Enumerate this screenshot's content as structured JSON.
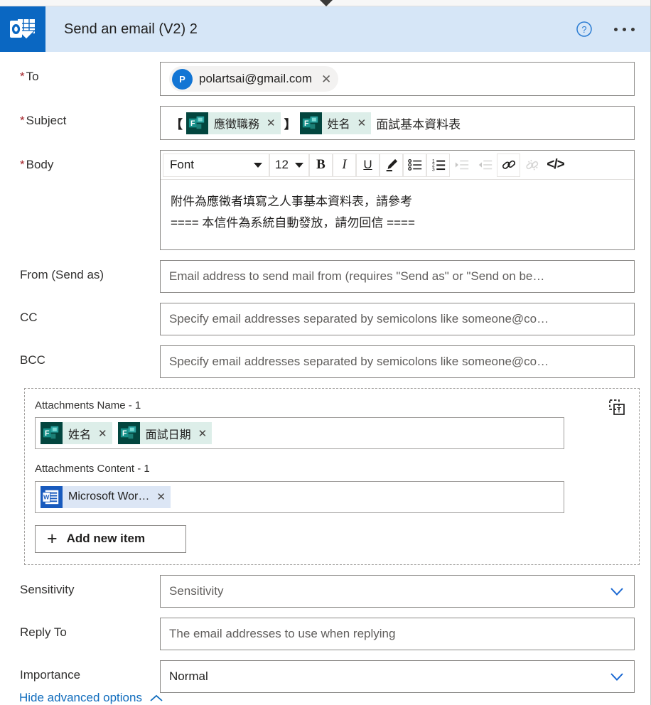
{
  "header": {
    "title": "Send an email (V2) 2",
    "app_icon": "outlook-icon",
    "help_icon": "help-circle-icon",
    "more_icon": "ellipsis-icon",
    "collapse_icon": "collapse-caret-icon",
    "background_color": "#d6e6f7",
    "icon_color": "#0a67c2"
  },
  "fields": {
    "to": {
      "label": "To",
      "required": true,
      "recipient": {
        "initial": "P",
        "email": "polartsai@gmail.com",
        "avatar_color": "#1275d4",
        "remove_label": "✕"
      }
    },
    "subject": {
      "label": "Subject",
      "required": true,
      "open_bracket": "【",
      "close_bracket": "】",
      "token1": {
        "label": "應徵職務",
        "icon": "microsoft-forms-icon",
        "remove_label": "✕"
      },
      "token2": {
        "label": "姓名",
        "icon": "microsoft-forms-icon",
        "remove_label": "✕"
      },
      "trailing_text": "面試基本資料表"
    },
    "body": {
      "label": "Body",
      "required": true,
      "line1": "附件為應徵者填寫之人事基本資料表，請參考",
      "line2": "==== 本信件為系統自動發放，請勿回信 ===="
    },
    "from": {
      "label": "From (Send as)",
      "placeholder": "Email address to send mail from (requires \"Send as\" or \"Send on be…"
    },
    "cc": {
      "label": "CC",
      "placeholder": "Specify email addresses separated by semicolons like someone@co…"
    },
    "bcc": {
      "label": "BCC",
      "placeholder": "Specify email addresses separated by semicolons like someone@co…"
    },
    "sensitivity": {
      "label": "Sensitivity",
      "placeholder": "Sensitivity",
      "chevron_icon": "chevron-down-icon"
    },
    "reply_to": {
      "label": "Reply To",
      "placeholder": "The email addresses to use when replying"
    },
    "importance": {
      "label": "Importance",
      "value": "Normal",
      "chevron_icon": "chevron-down-icon"
    }
  },
  "toolbar": {
    "font_name": "Font",
    "font_size": "12",
    "bold_label": "B",
    "italic_label": "I",
    "underline_label": "U",
    "highlight_icon": "highlighter-pen-icon",
    "bullet_list_icon": "bulleted-list-icon",
    "numbered_list_icon": "numbered-list-icon",
    "indent_icon": "increase-indent-icon",
    "outdent_icon": "decrease-indent-icon",
    "link_icon": "insert-link-icon",
    "unlink_icon": "remove-link-icon",
    "code_label": "</>"
  },
  "attachments": {
    "name_label": "Attachments Name - 1",
    "content_label": "Attachments Content - 1",
    "group_action_icon": "switch-to-text-mode-icon",
    "name_tokens": [
      {
        "label": "姓名",
        "icon": "microsoft-forms-icon",
        "remove_label": "✕"
      },
      {
        "label": "面試日期",
        "icon": "microsoft-forms-icon",
        "remove_label": "✕"
      }
    ],
    "content_tokens": [
      {
        "label": "Microsoft Wor…",
        "icon": "microsoft-word-icon",
        "remove_label": "✕"
      }
    ],
    "add_item_label": "Add new item",
    "add_item_icon": "plus-icon"
  },
  "footer": {
    "advanced_options_label": "Hide advanced options",
    "chevron_icon": "chevron-up-icon",
    "link_color": "#0f6cbd"
  }
}
